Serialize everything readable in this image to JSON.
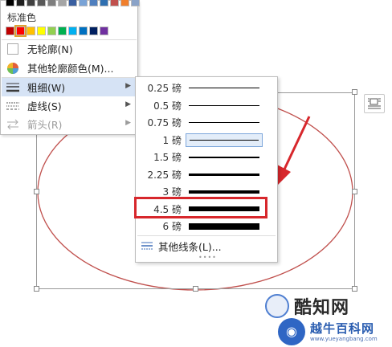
{
  "colors": {
    "theme_row": [
      "#000000",
      "#1f1f1f",
      "#404040",
      "#595959",
      "#7f7f7f",
      "#a5a5a5",
      "#3a5fa0",
      "#7aa3d6",
      "#4f7fbe",
      "#2f6fb0",
      "#c0504d",
      "#f07f2d",
      "#8aa3c8"
    ],
    "standard_row": [
      "#c00000",
      "#ff0000",
      "#ffc000",
      "#ffff00",
      "#92d050",
      "#00b050",
      "#00b0f0",
      "#0070c0",
      "#002060",
      "#7030a0"
    ],
    "accent": "#d7272c",
    "menu_highlight": "#d6e3f5",
    "ellipse_stroke": "#c0504d"
  },
  "outline_menu": {
    "standard_colors_label": "标准色",
    "no_outline": "无轮廓(N)",
    "more_colors": "其他轮廓颜色(M)...",
    "weight": "粗细(W)",
    "dashes": "虚线(S)",
    "arrows": "箭头(R)"
  },
  "weight_menu": {
    "items": [
      {
        "label": "0.25 磅",
        "weight": 0.25
      },
      {
        "label": "0.5 磅",
        "weight": 0.5
      },
      {
        "label": "0.75 磅",
        "weight": 0.75
      },
      {
        "label": "1 磅",
        "weight": 1
      },
      {
        "label": "1.5 磅",
        "weight": 1.5
      },
      {
        "label": "2.25 磅",
        "weight": 2.25
      },
      {
        "label": "3 磅",
        "weight": 3
      },
      {
        "label": "4.5 磅",
        "weight": 4.5
      },
      {
        "label": "6 磅",
        "weight": 6
      }
    ],
    "selected_index": 3,
    "highlighted_index": 7,
    "more_lines": "其他线条(L)..."
  },
  "watermark": {
    "brand": "酷知网",
    "sub": "越牛百科网",
    "url": "www.yueyangbang.com"
  }
}
